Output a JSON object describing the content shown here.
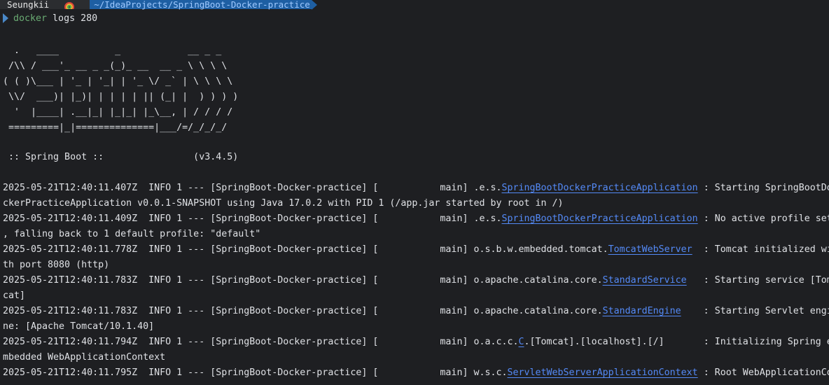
{
  "prompt": {
    "user": "Seungkii",
    "icon": "rainbow-icon",
    "path": "~/IdeaProjects/SpringBoot-Docker-practice",
    "accent": "#1e5fa3"
  },
  "command": {
    "name": "docker",
    "args": " logs 280"
  },
  "banner": {
    "art": "  .   ____          _            __ _ _\n /\\\\ / ___'_ __ _ _(_)_ __  __ _ \\ \\ \\ \\\n( ( )\\___ | '_ | '_| | '_ \\/ _` | \\ \\ \\ \\\n \\\\/  ___)| |_)| | | | | || (_| |  ) ) ) )\n  '  |____| .__|_| |_|_| |_\\__, | / / / /\n =========|_|==============|___/=/_/_/_/",
    "version_line": " :: Spring Boot ::                (v3.4.5)"
  },
  "log": {
    "link_color": "#548af7",
    "lines": [
      {
        "pre": "2025-05-21T12:40:11.407Z  INFO 1 --- [SpringBoot-Docker-practice] [           main] .e.s.",
        "link": "SpringBootDockerPracticeApplication",
        "post": " : Starting SpringBootDo"
      },
      {
        "pre": "ckerPracticeApplication v0.0.1-SNAPSHOT using Java 17.0.2 with PID 1 (/app.jar started by root in /)",
        "link": "",
        "post": ""
      },
      {
        "pre": "2025-05-21T12:40:11.409Z  INFO 1 --- [SpringBoot-Docker-practice] [           main] .e.s.",
        "link": "SpringBootDockerPracticeApplication",
        "post": " : No active profile set"
      },
      {
        "pre": ", falling back to 1 default profile: \"default\"",
        "link": "",
        "post": ""
      },
      {
        "pre": "2025-05-21T12:40:11.778Z  INFO 1 --- [SpringBoot-Docker-practice] [           main] o.s.b.w.embedded.tomcat.",
        "link": "TomcatWebServer",
        "post": "  : Tomcat initialized wi"
      },
      {
        "pre": "th port 8080 (http)",
        "link": "",
        "post": ""
      },
      {
        "pre": "2025-05-21T12:40:11.783Z  INFO 1 --- [SpringBoot-Docker-practice] [           main] o.apache.catalina.core.",
        "link": "StandardService",
        "post": "   : Starting service [Tom"
      },
      {
        "pre": "cat]",
        "link": "",
        "post": ""
      },
      {
        "pre": "2025-05-21T12:40:11.783Z  INFO 1 --- [SpringBoot-Docker-practice] [           main] o.apache.catalina.core.",
        "link": "StandardEngine",
        "post": "    : Starting Servlet engi"
      },
      {
        "pre": "ne: [Apache Tomcat/10.1.40]",
        "link": "",
        "post": ""
      },
      {
        "pre": "2025-05-21T12:40:11.794Z  INFO 1 --- [SpringBoot-Docker-practice] [           main] o.a.c.c.",
        "link": "C",
        "post": ".[Tomcat].[localhost].[/]       : Initializing Spring e"
      },
      {
        "pre": "mbedded WebApplicationContext",
        "link": "",
        "post": ""
      },
      {
        "pre": "2025-05-21T12:40:11.795Z  INFO 1 --- [SpringBoot-Docker-practice] [           main] w.s.c.",
        "link": "ServletWebServerApplicationContext",
        "post": " : Root WebApplicationCo"
      }
    ]
  }
}
